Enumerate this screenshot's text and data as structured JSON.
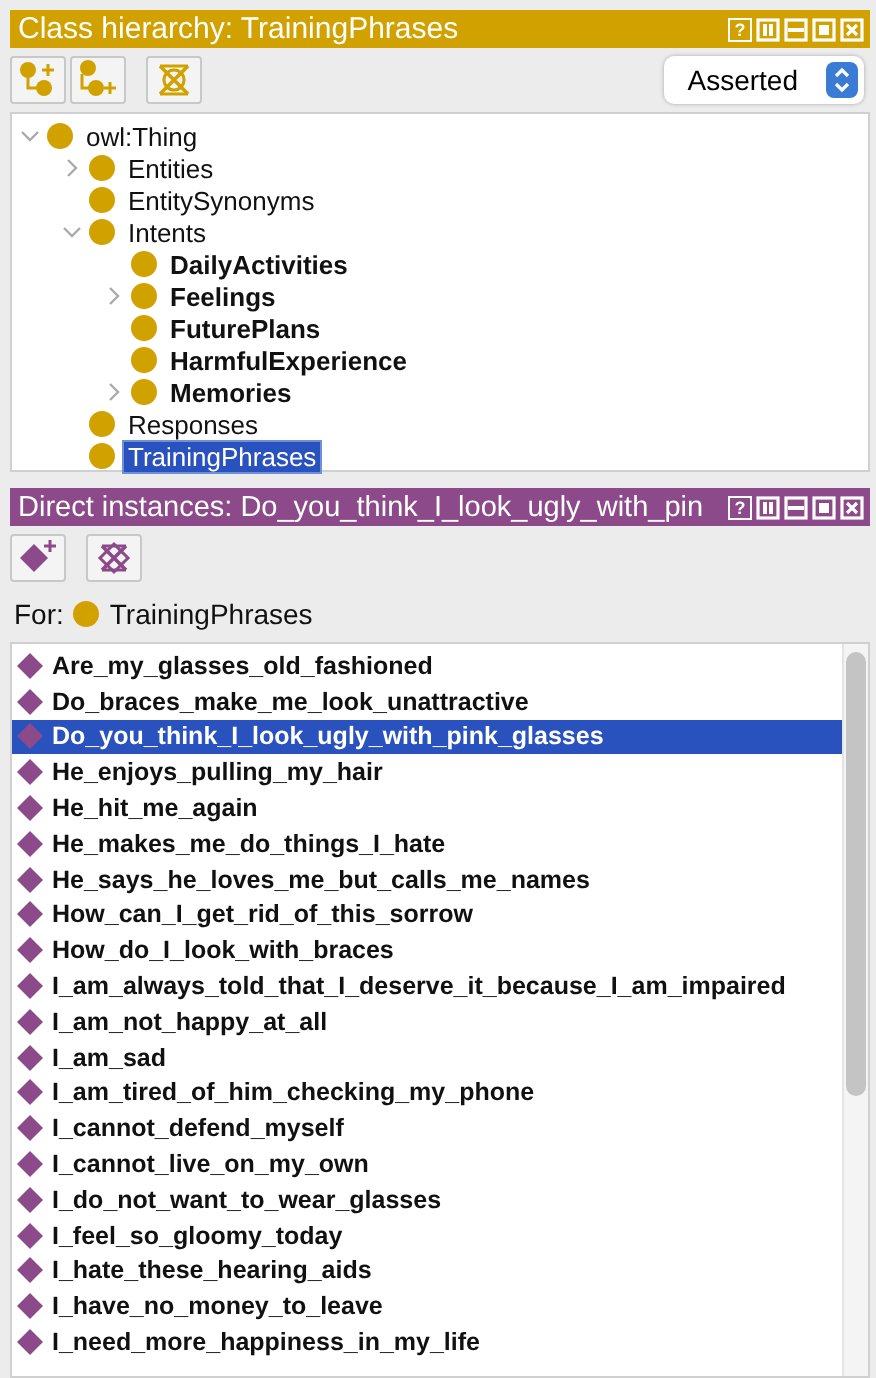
{
  "class_panel": {
    "title": "Class hierarchy: TrainingPhrases",
    "header_buttons": [
      {
        "kind": "help",
        "label": "?"
      },
      {
        "kind": "split"
      },
      {
        "kind": "minimize"
      },
      {
        "kind": "maximize"
      },
      {
        "kind": "close"
      }
    ],
    "tools": [
      {
        "kind": "add-subclass"
      },
      {
        "kind": "add-sibling"
      },
      {
        "kind": "delete"
      }
    ],
    "dropdown": {
      "value": "Asserted"
    },
    "tree": [
      {
        "label": "owl:Thing",
        "expanded": true,
        "bold": false,
        "selected": false,
        "children": [
          {
            "label": "Entities",
            "expanded": false,
            "bold": false,
            "selected": false,
            "has_children": true
          },
          {
            "label": "EntitySynonyms",
            "expanded": false,
            "bold": false,
            "selected": false,
            "has_children": false
          },
          {
            "label": "Intents",
            "expanded": true,
            "bold": false,
            "selected": false,
            "children": [
              {
                "label": "DailyActivities",
                "expanded": false,
                "bold": true,
                "selected": false,
                "has_children": false
              },
              {
                "label": "Feelings",
                "expanded": false,
                "bold": true,
                "selected": false,
                "has_children": true
              },
              {
                "label": "FuturePlans",
                "expanded": false,
                "bold": true,
                "selected": false,
                "has_children": false
              },
              {
                "label": "HarmfulExperience",
                "expanded": false,
                "bold": true,
                "selected": false,
                "has_children": false
              },
              {
                "label": "Memories",
                "expanded": false,
                "bold": true,
                "selected": false,
                "has_children": true
              }
            ]
          },
          {
            "label": "Responses",
            "expanded": false,
            "bold": false,
            "selected": false,
            "has_children": false
          },
          {
            "label": "TrainingPhrases",
            "expanded": false,
            "bold": false,
            "selected": true,
            "has_children": false
          }
        ]
      }
    ]
  },
  "instance_panel": {
    "title": "Direct instances: Do_you_think_I_look_ugly_with_pin",
    "header_buttons": [
      {
        "kind": "help",
        "label": "?"
      },
      {
        "kind": "split"
      },
      {
        "kind": "minimize"
      },
      {
        "kind": "maximize"
      },
      {
        "kind": "close"
      }
    ],
    "tools": [
      {
        "kind": "add-instance"
      },
      {
        "kind": "delete-instance"
      }
    ],
    "for_label": "For:",
    "for_class": "TrainingPhrases",
    "instances": [
      {
        "label": "Are_my_glasses_old_fashioned",
        "selected": false
      },
      {
        "label": "Do_braces_make_me_look_unattractive",
        "selected": false
      },
      {
        "label": "Do_you_think_I_look_ugly_with_pink_glasses",
        "selected": true
      },
      {
        "label": "He_enjoys_pulling_my_hair",
        "selected": false
      },
      {
        "label": "He_hit_me_again",
        "selected": false
      },
      {
        "label": "He_makes_me_do_things_I_hate",
        "selected": false
      },
      {
        "label": "He_says_he_loves_me_but_calls_me_names",
        "selected": false
      },
      {
        "label": "How_can_I_get_rid_of_this_sorrow",
        "selected": false
      },
      {
        "label": "How_do_I_look_with_braces",
        "selected": false
      },
      {
        "label": "I_am_always_told_that_I_deserve_it_because_I_am_impaired",
        "selected": false
      },
      {
        "label": "I_am_not_happy_at_all",
        "selected": false
      },
      {
        "label": "I_am_sad",
        "selected": false
      },
      {
        "label": "I_am_tired_of_him_checking_my_phone",
        "selected": false
      },
      {
        "label": "I_cannot_defend_myself",
        "selected": false
      },
      {
        "label": "I_cannot_live_on_my_own",
        "selected": false
      },
      {
        "label": "I_do_not_want_to_wear_glasses",
        "selected": false
      },
      {
        "label": "I_feel_so_gloomy_today",
        "selected": false
      },
      {
        "label": "I_hate_these_hearing_aids",
        "selected": false
      },
      {
        "label": "I_have_no_money_to_leave",
        "selected": false
      },
      {
        "label": "I_need_more_happiness_in_my_life",
        "selected": false
      }
    ]
  }
}
